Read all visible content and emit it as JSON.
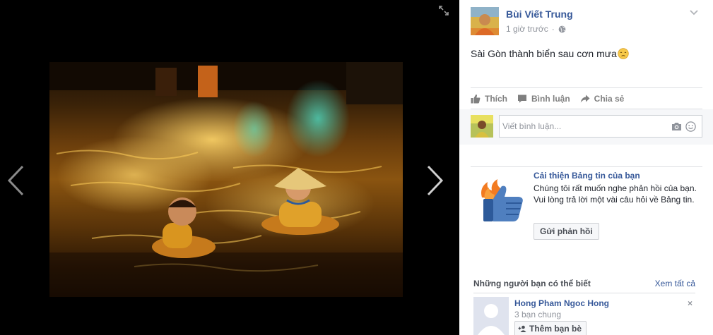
{
  "post": {
    "author_name": "Bùi Viết Trung",
    "time": "1 giờ trước",
    "dot": "·",
    "text": "Sài Gòn thành biển sau cơn mưa"
  },
  "actions": {
    "like_label": "Thích",
    "comment_label": "Bình luận",
    "share_label": "Chia sẻ"
  },
  "comment": {
    "placeholder": "Viết bình luận..."
  },
  "feed_improve": {
    "title": "Cải thiện Bảng tin của bạn",
    "description": "Chúng tôi rất muốn nghe phản hồi của bạn. Vui lòng trả lời một vài câu hỏi về Bảng tin.",
    "button_label": "Gửi phản hồi"
  },
  "pymk": {
    "title": "Những người bạn có thể biết",
    "see_all": "Xem tất cả",
    "person": {
      "name": "Hong Pham Ngoc Hong",
      "mutual": "3 bạn chung",
      "add_label": "Thêm bạn bè",
      "close": "×"
    }
  },
  "colors": {
    "link": "#365899",
    "muted": "#90949c",
    "viewer_bg": "#000000",
    "panel_bg": "#ffffff"
  },
  "icons": [
    "expand-icon",
    "chevron-left-icon",
    "chevron-right-icon",
    "globe-icon",
    "chevron-down-icon",
    "sad-emoji-icon",
    "like-icon",
    "comment-icon",
    "share-icon",
    "camera-icon",
    "smile-icon",
    "thumbs-up-icon",
    "add-friend-icon",
    "close-icon"
  ]
}
